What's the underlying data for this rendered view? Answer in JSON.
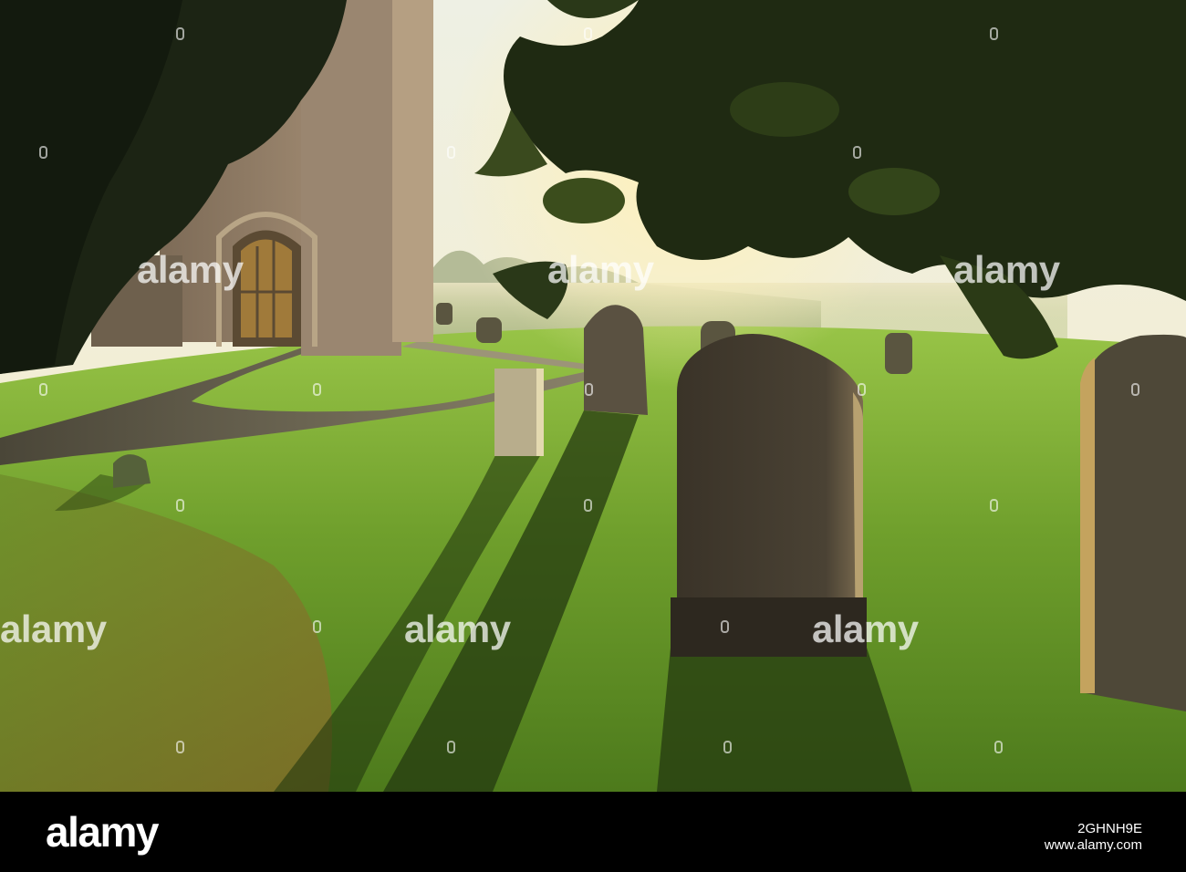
{
  "watermark": {
    "brand": "alamy",
    "repeat_label": "alamy"
  },
  "footer": {
    "logo_text": "alamy",
    "image_id": "2GHNH9E",
    "url": "www.alamy.com"
  },
  "palette": {
    "sky": "#f4f0dc",
    "grass_lit": "#7fb23a",
    "grass_shadow": "#2f4a17",
    "stone": "#8c7a66",
    "sun": "#fff6cc"
  }
}
